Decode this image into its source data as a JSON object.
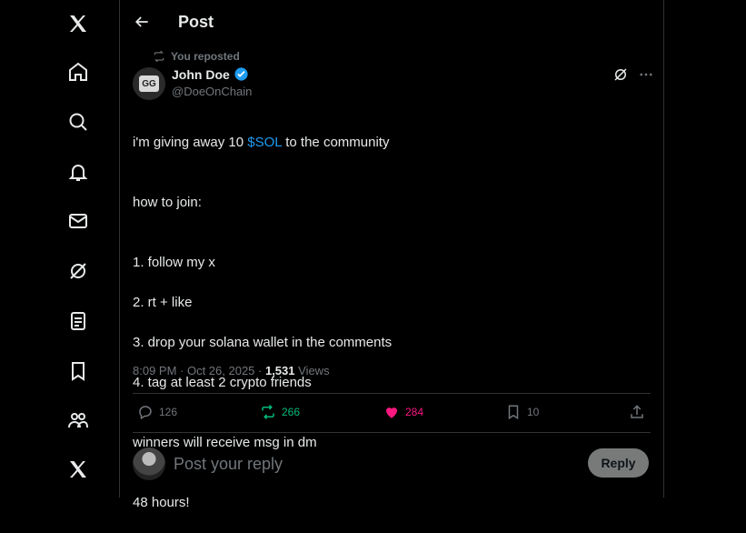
{
  "header": {
    "title": "Post"
  },
  "post": {
    "repost_label": "You reposted",
    "avatar_text": "GG",
    "author_name": "John Doe",
    "author_handle": "@DoeOnChain",
    "lines": {
      "l1_prefix": "i'm giving away 10 ",
      "l1_cashtag": "$SOL",
      "l1_suffix": " to the community",
      "l2": "how to join:",
      "l3": "1. follow my x",
      "l4": "2. rt + like",
      "l5": "3. drop your solana wallet in the comments",
      "l6": "4. tag at least 2 crypto friends",
      "l7": "winners will receive msg in dm",
      "l8": "48 hours!"
    },
    "timestamp": "8:09 PM · Oct 26, 2025 · ",
    "views_count": "1,531",
    "views_label": " Views",
    "stats": {
      "replies": "126",
      "reposts": "266",
      "likes": "284",
      "bookmarks": "10"
    }
  },
  "reply": {
    "placeholder": "Post your reply",
    "button_label": "Reply"
  },
  "colors": {
    "accent": "#1d9bf0",
    "repost": "#00ba7c",
    "like": "#f91880"
  },
  "sidebar_icons": [
    "x-logo-icon",
    "home-icon",
    "search-icon",
    "notifications-icon",
    "messages-icon",
    "grok-icon",
    "lists-icon",
    "bookmarks-icon",
    "communities-icon",
    "premium-x-icon"
  ]
}
